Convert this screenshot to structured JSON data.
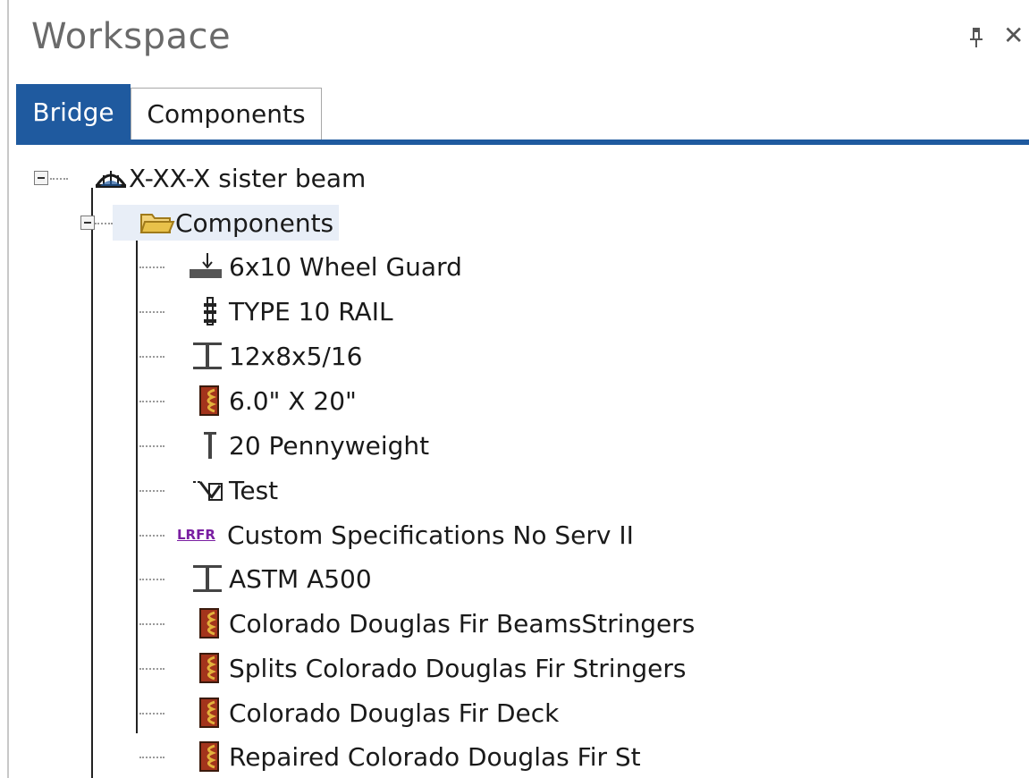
{
  "panel": {
    "title": "Workspace"
  },
  "tabs": [
    {
      "label": "Bridge",
      "active": true
    },
    {
      "label": "Components",
      "active": false
    }
  ],
  "tree": {
    "root": {
      "label": "X-XX-X sister beam",
      "icon": "bridge-icon",
      "expanded": true
    },
    "folder": {
      "label": "Components",
      "icon": "folder-open-icon",
      "expanded": true
    },
    "items": [
      {
        "label": "6x10 Wheel Guard",
        "icon": "wheel-guard-icon"
      },
      {
        "label": "TYPE 10 RAIL",
        "icon": "railing-icon"
      },
      {
        "label": "12x8x5/16",
        "icon": "steel-beam-icon"
      },
      {
        "label": "6.0\" X 20\"",
        "icon": "timber-icon"
      },
      {
        "label": "20 Pennyweight",
        "icon": "nail-icon"
      },
      {
        "label": "Test",
        "icon": "test-profile-icon"
      },
      {
        "label": "Custom Specifications No Serv II",
        "icon": "lrfr-icon",
        "icon_text": "LRFR"
      },
      {
        "label": "ASTM A500",
        "icon": "steel-beam-icon"
      },
      {
        "label": "Colorado Douglas Fir BeamsStringers",
        "icon": "timber-icon"
      },
      {
        "label": "Splits Colorado Douglas Fir Stringers",
        "icon": "timber-icon"
      },
      {
        "label": "Colorado Douglas Fir Deck",
        "icon": "timber-icon"
      },
      {
        "label": "Repaired Colorado Douglas Fir St",
        "icon": "timber-icon"
      }
    ]
  },
  "colors": {
    "accent": "#1f5a9f",
    "timber_fill": "#a3341c",
    "timber_grain": "#e3b23c",
    "lrfr": "#7a1fa2",
    "folder": "#e8c14a"
  }
}
